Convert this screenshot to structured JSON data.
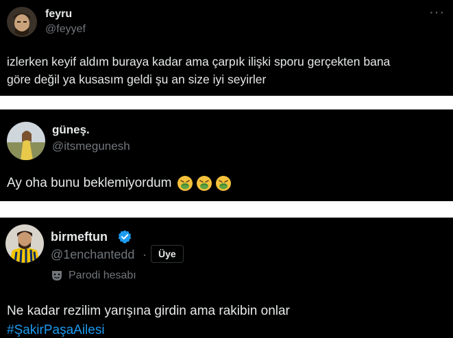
{
  "colors": {
    "background": "#000000",
    "text": "#e7e9ea",
    "muted": "#71767b",
    "link": "#1d9bf0",
    "verified": "#1d9bf0"
  },
  "tweets": [
    {
      "author_name": "feyru",
      "handle": "@feyyef",
      "more_icon": "more-horizontal-icon",
      "text_line1": "izlerken keyif aldım buraya kadar ama çarpık ilişki sporu gerçekten bana",
      "text_line2": "göre değil ya kusasım geldi şu an size iyi seyirler"
    },
    {
      "author_name": "güneş.",
      "handle": "@itsmegunesh",
      "text": "Ay oha bunu beklemiyordum",
      "emojis": [
        "nauseated-face-icon",
        "nauseated-face-icon",
        "nauseated-face-icon"
      ]
    },
    {
      "author_name": "birmeftun",
      "verified_icon": "verified-badge-icon",
      "handle": "@1enchantedd",
      "separator": "·",
      "badge": "Üye",
      "parody_icon": "theater-mask-icon",
      "parody_label": "Parodi hesabı",
      "text": "Ne kadar rezilim yarışına girdin ama rakibin onlar",
      "hashtag": "#ŞakirPaşaAilesi"
    }
  ]
}
